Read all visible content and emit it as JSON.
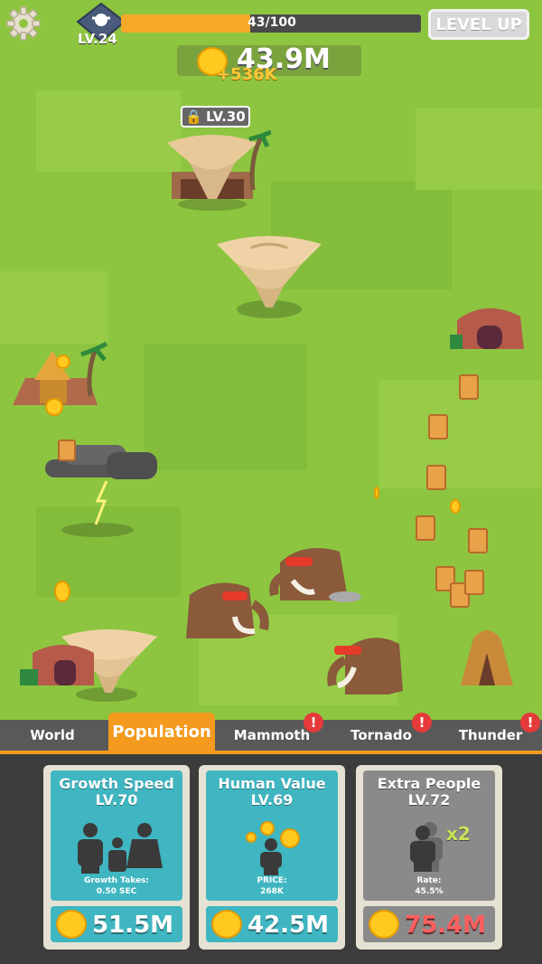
{
  "hud": {
    "level": "LV.24",
    "xp_text": "43/100",
    "xp_fraction": 0.43,
    "level_up_label": "LEVEL UP",
    "coins": "43.9M",
    "coin_gain": "+536K"
  },
  "world": {
    "locked_level": "LV.30"
  },
  "tabs": [
    {
      "label": "World"
    },
    {
      "label": "Population"
    },
    {
      "label": "Mammoth"
    },
    {
      "label": "Tornado"
    },
    {
      "label": "Thunder"
    }
  ],
  "cards": [
    {
      "title": "Growth Speed",
      "level": "LV.70",
      "sub_label": "Growth Takes:",
      "sub_value": "0.50 SEC",
      "price": "51.5M"
    },
    {
      "title": "Human Value",
      "level": "LV.69",
      "sub_label": "PRICE:",
      "sub_value": "268K",
      "price": "42.5M"
    },
    {
      "title": "Extra People",
      "level": "LV.72",
      "badge": "x2",
      "sub_label": "Rate:",
      "sub_value": "45.5%",
      "price": "75.4M"
    }
  ],
  "colors": {
    "grass": "#8dc540",
    "accent": "#f39a1f",
    "card_teal": "#3fb6c1",
    "card_disabled": "#8a8a8a",
    "alert": "#e63a3a"
  }
}
